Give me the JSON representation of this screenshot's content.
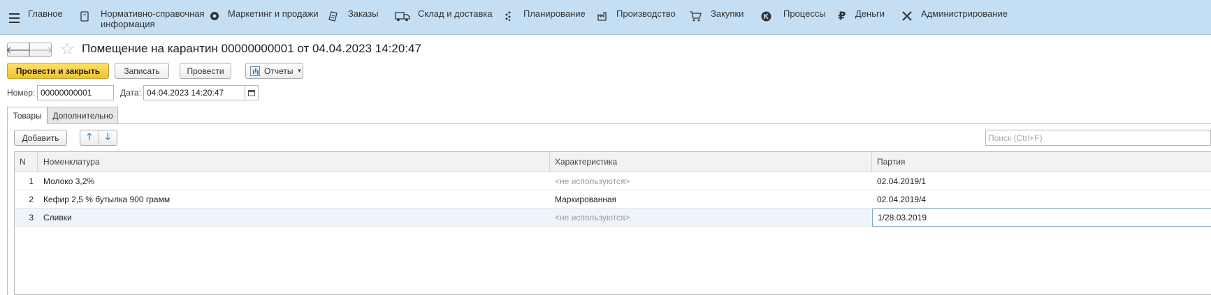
{
  "menu": {
    "items": [
      {
        "label": "Главное",
        "icon": "menu-icon"
      },
      {
        "label": "Нормативно-справочная\nинформация",
        "icon": "reference-book-icon"
      },
      {
        "label": "Маркетинг и продажи",
        "icon": "marketing-icon"
      },
      {
        "label": "Заказы",
        "icon": "orders-icon"
      },
      {
        "label": "Склад и доставка",
        "icon": "truck-icon"
      },
      {
        "label": "Планирование",
        "icon": "planning-icon"
      },
      {
        "label": "Производство",
        "icon": "factory-icon"
      },
      {
        "label": "Закупки",
        "icon": "cart-icon"
      },
      {
        "label": "Процессы",
        "icon": "processes-icon"
      },
      {
        "label": "Деньги",
        "icon": "ruble-icon"
      },
      {
        "label": "Администрирование",
        "icon": "tools-icon"
      }
    ]
  },
  "document": {
    "title": "Помещение на карантин 00000000001 от 04.04.2023 14:20:47"
  },
  "toolbar": {
    "post_close_label": "Провести и закрыть",
    "save_label": "Записать",
    "post_label": "Провести",
    "reports_label": "Отчеты"
  },
  "fields": {
    "number_label": "Номер:",
    "number_value": "00000000001",
    "date_label": "Дата:",
    "date_value": "04.04.2023 14:20:47"
  },
  "tabs": [
    {
      "label": "Товары",
      "active": true
    },
    {
      "label": "Дополнительно",
      "active": false
    }
  ],
  "table_toolbar": {
    "add_label": "Добавить",
    "search_placeholder": "Поиск (Ctrl+F)"
  },
  "table": {
    "columns": [
      "N",
      "Номенклатура",
      "Характеристика",
      "Партия"
    ],
    "rows": [
      {
        "n": "1",
        "item": "Молоко 3,2%",
        "characteristic": "<не используются>",
        "batch": "02.04.2019/1"
      },
      {
        "n": "2",
        "item": "Кефир 2,5 % бутылка 900 грамм",
        "characteristic": "Маркированная",
        "batch": "02.04.2019/4"
      },
      {
        "n": "3",
        "item": "Сливки",
        "characteristic": "<не используются>",
        "batch": "1/28.03.2019"
      }
    ]
  },
  "colors": {
    "menu_bg": "#c4dff4",
    "primary_button": "#f2c12c",
    "selected_row": "#eef4fb"
  }
}
